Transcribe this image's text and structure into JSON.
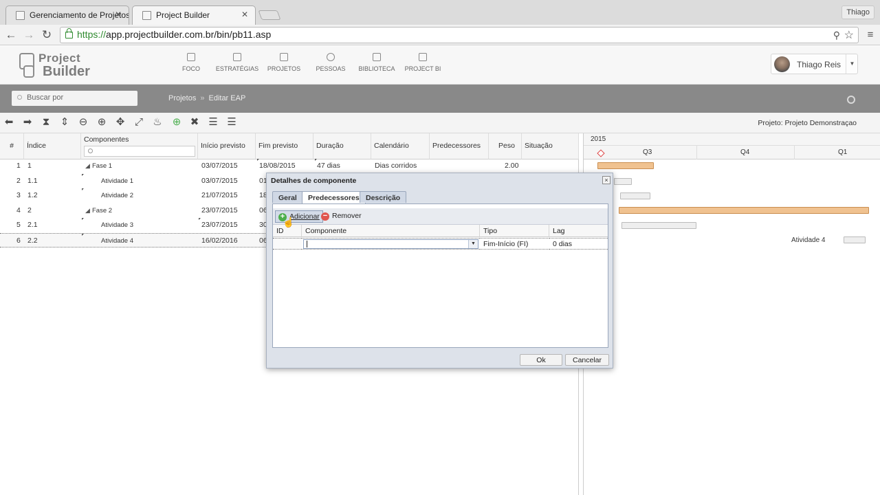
{
  "browser": {
    "tabs": [
      {
        "title": "Gerenciamento de Projetos"
      },
      {
        "title": "Project Builder"
      }
    ],
    "user_badge": "Thiago",
    "url_https": "https://",
    "url_rest": "app.projectbuilder.com.br/bin/pb11.asp"
  },
  "app": {
    "logo_line1": "Project",
    "logo_line2": "Builder",
    "nav": [
      "FOCO",
      "ESTRATÉGIAS",
      "PROJETOS",
      "PESSOAS",
      "BIBLIOTECA",
      "PROJECT BI"
    ],
    "user_name": "Thiago Reis",
    "search_placeholder": "Buscar por",
    "breadcrumb": [
      "Projetos",
      "Editar EAP"
    ],
    "breadcrumb_sep": "»",
    "project_label": "Projeto: Projeto Demonstraçao"
  },
  "grid": {
    "headers": [
      "#",
      "Índice",
      "Componentes",
      "Início previsto",
      "Fim previsto",
      "Duração",
      "Calendário",
      "Predecessores",
      "Peso",
      "Situação"
    ],
    "rows": [
      {
        "n": "1",
        "idx": "1",
        "comp": "Fase 1",
        "ini": "03/07/2015",
        "fim": "18/08/2015",
        "dur": "47 dias",
        "cal": "Dias corridos",
        "peso": "2.00"
      },
      {
        "n": "2",
        "idx": "1.1",
        "comp": "Atividade 1",
        "ini": "03/07/2015",
        "fim": "01",
        "dur": "",
        "cal": "",
        "peso": ""
      },
      {
        "n": "3",
        "idx": "1.2",
        "comp": "Atividade 2",
        "ini": "21/07/2015",
        "fim": "18",
        "dur": "",
        "cal": "",
        "peso": ""
      },
      {
        "n": "4",
        "idx": "2",
        "comp": "Fase 2",
        "ini": "23/07/2015",
        "fim": "06",
        "dur": "",
        "cal": "",
        "peso": ""
      },
      {
        "n": "5",
        "idx": "2.1",
        "comp": "Atividade 3",
        "ini": "23/07/2015",
        "fim": "30",
        "dur": "",
        "cal": "",
        "peso": ""
      },
      {
        "n": "6",
        "idx": "2.2",
        "comp": "Atividade 4",
        "ini": "16/02/2016",
        "fim": "06",
        "dur": "",
        "cal": "",
        "peso": ""
      }
    ]
  },
  "gantt": {
    "year": "2015",
    "quarters": [
      "Q3",
      "Q4",
      "Q1"
    ],
    "bar_label": "Atividade 4"
  },
  "dialog": {
    "title": "Detalhes de componente",
    "close": "×",
    "tabs": [
      "Geral",
      "Predecessores",
      "Descrição"
    ],
    "add_label": "Adicionar",
    "remove_label": "Remover",
    "columns": [
      "ID",
      "Componente",
      "Tipo",
      "Lag"
    ],
    "row": {
      "tipo": "Fim-Início (FI)",
      "lag": "0 dias"
    },
    "ok": "Ok",
    "cancel": "Cancelar"
  }
}
